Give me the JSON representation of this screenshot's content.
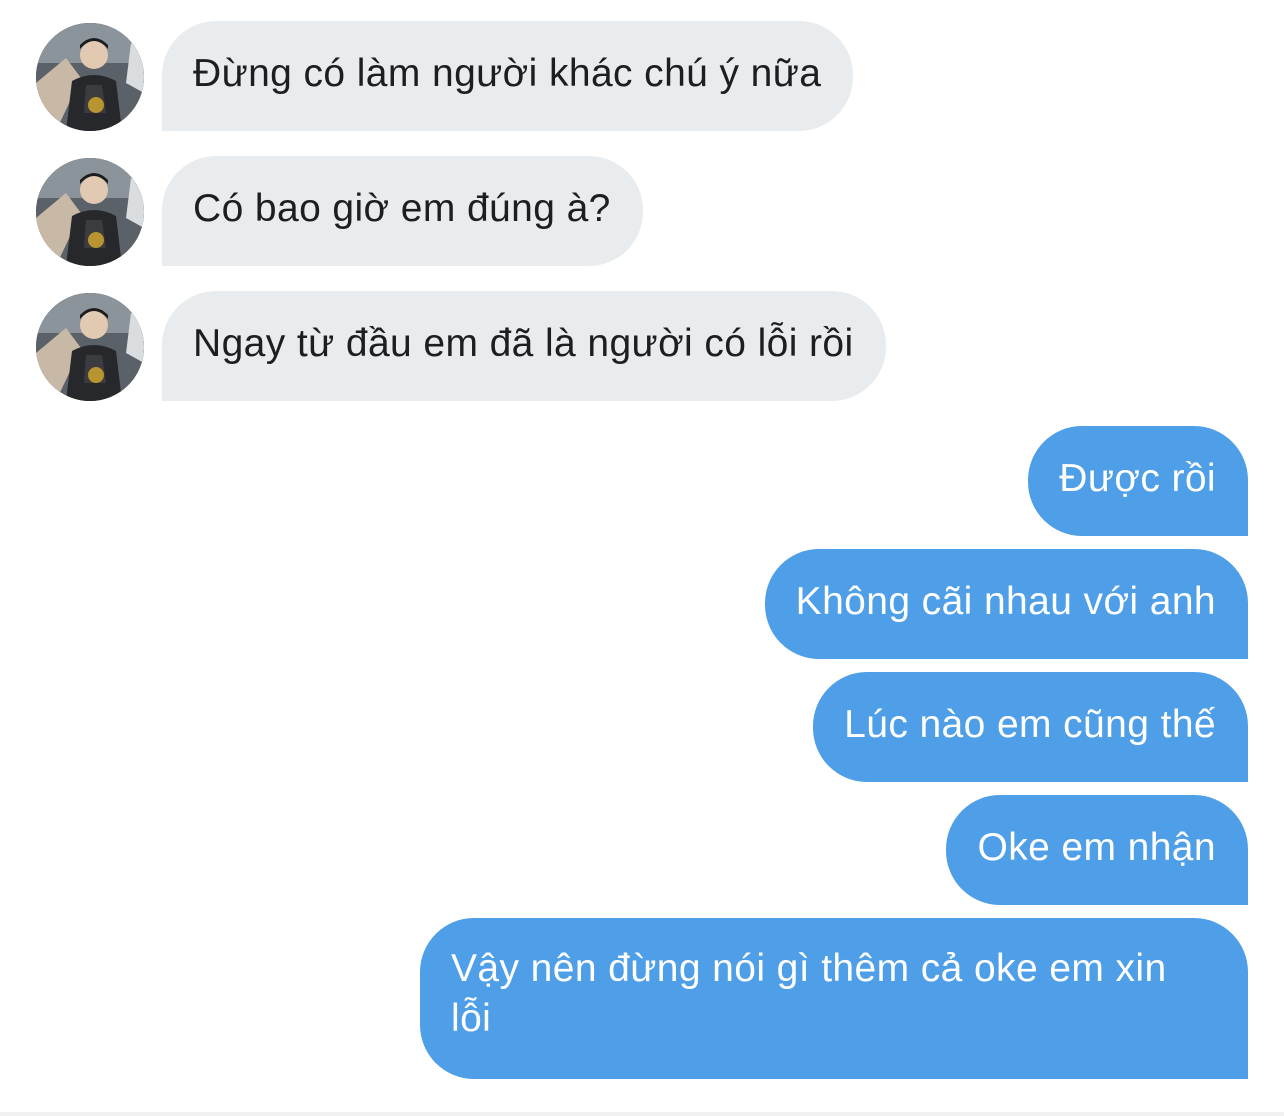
{
  "colors": {
    "incoming_bubble": "#e9ecef",
    "outgoing_bubble": "#4f9ee8",
    "incoming_text": "#1c1e21",
    "outgoing_text": "#ffffff"
  },
  "avatar": {
    "icon": "avatar-photo"
  },
  "messages": [
    {
      "side": "incoming",
      "text": "Đừng có làm người khác chú ý nữa"
    },
    {
      "side": "incoming",
      "text": "Có bao giờ em đúng à?"
    },
    {
      "side": "incoming",
      "text": "Ngay từ đầu em đã là người có lỗi rồi"
    },
    {
      "side": "outgoing",
      "text": "Được rồi"
    },
    {
      "side": "outgoing",
      "text": "Không cãi nhau với anh"
    },
    {
      "side": "outgoing",
      "text": "Lúc nào em cũng thế"
    },
    {
      "side": "outgoing",
      "text": "Oke em nhận"
    },
    {
      "side": "outgoing",
      "text": "Vậy nên đừng nói gì thêm cả oke em xin lỗi"
    }
  ]
}
